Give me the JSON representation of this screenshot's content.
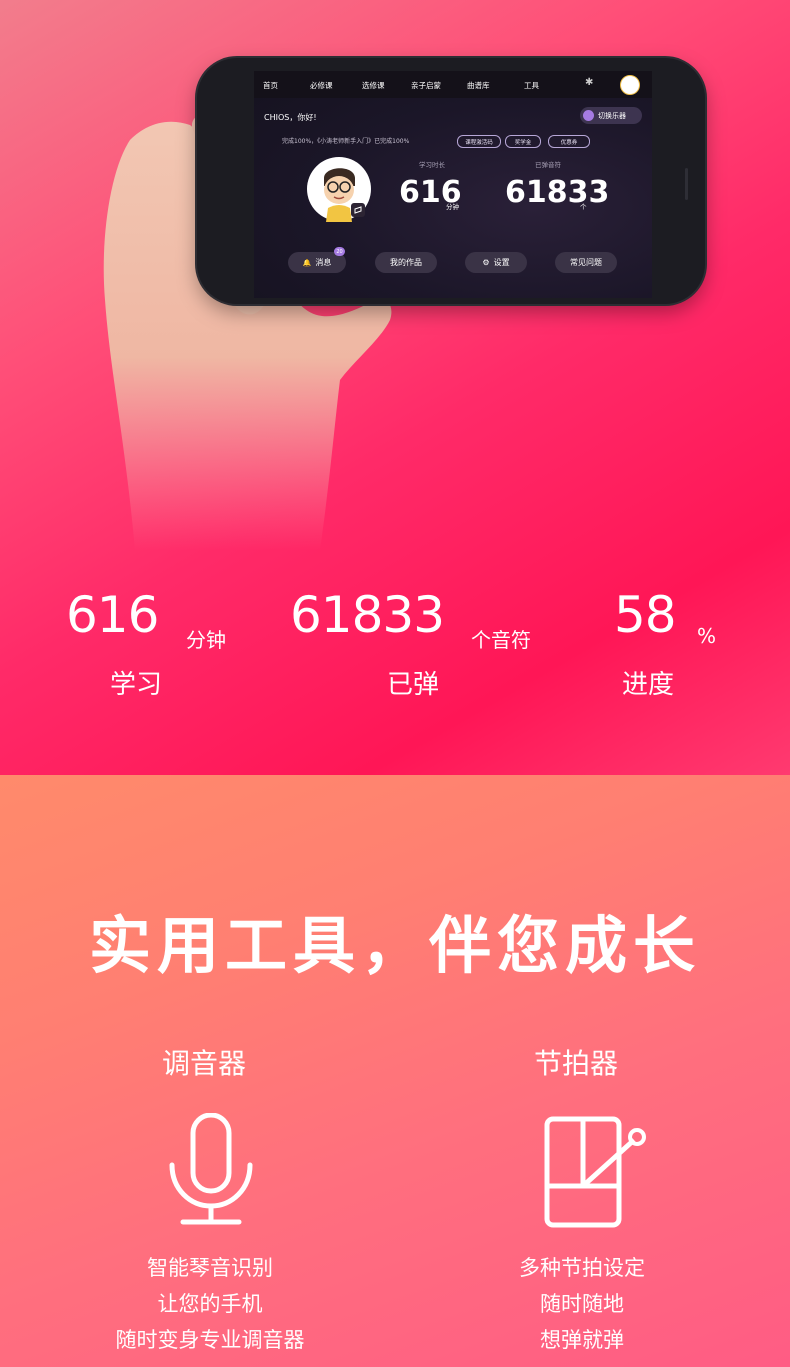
{
  "phone": {
    "nav": [
      "首页",
      "必修课",
      "选修课",
      "亲子启蒙",
      "曲谱库",
      "工具"
    ],
    "greeting": "CHIOS，你好!",
    "switch_label": "切换乐器",
    "progress_text": "完成100%，《小涛老师新手入门》已完成100%",
    "mini_buttons": [
      "课程激活码",
      "奖学金",
      "优惠券"
    ],
    "study_time_label": "学习时长",
    "study_time_value": "616",
    "study_time_unit": "分钟",
    "notes_label": "已弹音符",
    "notes_value": "61833",
    "notes_unit": "个",
    "actions": [
      "消息",
      "我的作品",
      "设置",
      "常见问题"
    ],
    "badge": "20"
  },
  "stats": [
    {
      "value": "616",
      "unit": "分钟",
      "label": "学习"
    },
    {
      "value": "61833",
      "unit": "个音符",
      "label": "已弹"
    },
    {
      "value": "58",
      "unit": "%",
      "label": "进度"
    }
  ],
  "headline": "实用工具，伴您成长",
  "tools": [
    {
      "title": "调音器",
      "icon": "microphone-icon",
      "lines": [
        "智能琴音识别",
        "让您的手机",
        "随时变身专业调音器"
      ]
    },
    {
      "title": "节拍器",
      "icon": "metronome-icon",
      "lines": [
        "多种节拍设定",
        "随时随地",
        "想弹就弹"
      ]
    }
  ]
}
